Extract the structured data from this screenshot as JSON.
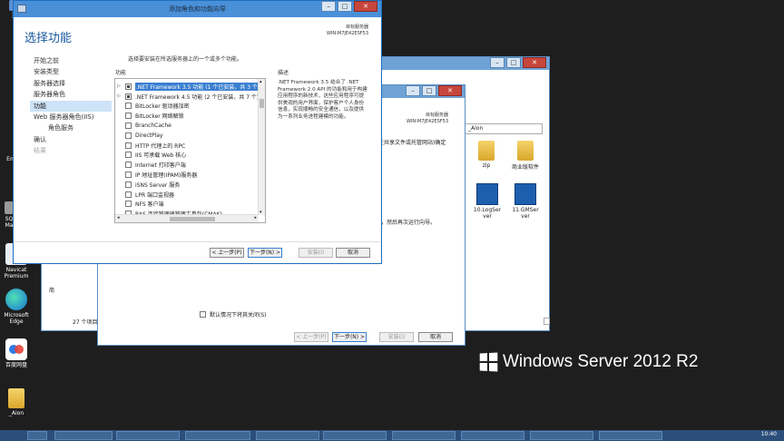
{
  "desktop": {
    "icons": [
      {
        "label": "Navicat Premium"
      },
      {
        "label": "Microsoft Edge"
      },
      {
        "label": "百度网盘"
      },
      {
        "label": "_Aion"
      }
    ],
    "edge_labels": [
      "这",
      "Em",
      "SQ",
      "Ma"
    ],
    "brand": "Windows Server 2012 R2"
  },
  "explorer": {
    "address": "_Aion",
    "files": [
      {
        "label": "zip"
      },
      {
        "label": "商业版软件"
      },
      {
        "label": "10.LogSer ver"
      },
      {
        "label": "11.GMSer ver"
      }
    ],
    "item_count": "27 个项目",
    "nav_partial": "简"
  },
  "back_wizard": {
    "server_label": "目标服务器",
    "server_name": "WIN-M7JE42ESF53",
    "text_share": "在共享文件或托管网站)确定",
    "text_run": "，然后再次运行向导。",
    "restart_checkbox": "默认情况下将其关闭(S)",
    "buttons": {
      "prev": "< 上一步(P)",
      "next": "下一步(N) >",
      "install": "安装(I)",
      "cancel": "取消"
    }
  },
  "wizard": {
    "title": "添加角色和功能向导",
    "heading": "选择功能",
    "server_label": "目标服务器",
    "server_name": "WIN-M7JE42ESF53",
    "nav": [
      {
        "label": "开始之前",
        "state": "normal"
      },
      {
        "label": "安装类型",
        "state": "normal"
      },
      {
        "label": "服务器选择",
        "state": "normal"
      },
      {
        "label": "服务器角色",
        "state": "normal"
      },
      {
        "label": "功能",
        "state": "active"
      },
      {
        "label": "Web 服务器角色(IIS)",
        "state": "normal"
      },
      {
        "label": "角色服务",
        "state": "sub"
      },
      {
        "label": "确认",
        "state": "normal"
      },
      {
        "label": "结果",
        "state": "disabled"
      }
    ],
    "instruction": "选择要安装在所选服务器上的一个或多个功能。",
    "features_label": "功能",
    "description_label": "描述",
    "features": [
      {
        "label": ".NET Framework 3.5 功能 (1 个已安装，共 3 个)",
        "expandable": true,
        "state": "partial",
        "selected": true
      },
      {
        "label": ".NET Framework 4.5 功能 (2 个已安装，共 7 个)",
        "expandable": true,
        "state": "partial",
        "selected": false
      },
      {
        "label": "BitLocker 驱动器加密",
        "expandable": false,
        "state": "none",
        "selected": false
      },
      {
        "label": "BitLocker 网络解锁",
        "expandable": false,
        "state": "none",
        "selected": false
      },
      {
        "label": "BranchCache",
        "expandable": false,
        "state": "none",
        "selected": false
      },
      {
        "label": "DirectPlay",
        "expandable": false,
        "state": "none",
        "selected": false
      },
      {
        "label": "HTTP 代理上的 RPC",
        "expandable": false,
        "state": "none",
        "selected": false
      },
      {
        "label": "IIS 可承载 Web 核心",
        "expandable": false,
        "state": "none",
        "selected": false
      },
      {
        "label": "Internet 打印客户端",
        "expandable": false,
        "state": "none",
        "selected": false
      },
      {
        "label": "IP 地址管理(IPAM)服务器",
        "expandable": false,
        "state": "none",
        "selected": false
      },
      {
        "label": "iSNS Server 服务",
        "expandable": false,
        "state": "none",
        "selected": false
      },
      {
        "label": "LPR 端口监视器",
        "expandable": false,
        "state": "none",
        "selected": false
      },
      {
        "label": "NFS 客户端",
        "expandable": false,
        "state": "none",
        "selected": false
      },
      {
        "label": "RAS 连接管理器管理工具包(CMAK)",
        "expandable": false,
        "state": "none",
        "selected": false
      }
    ],
    "description": ".NET Framework 3.5 结合了 .NET Framework 2.0 API 的功能和用于构建应用程序的新技术，这些应用程序可提供美观的用户界面，保护客户个人身份信息，实现顺畅的安全通信，以及提供为一系列业务进程建模的功能。",
    "buttons": {
      "prev": "< 上一步(P)",
      "next": "下一步(N) >",
      "install": "安装(I)",
      "cancel": "取消"
    }
  },
  "taskbar": {
    "time": "10:40"
  },
  "colors": {
    "titlebar": "#4a90d9",
    "heading": "#1a5aa0",
    "selection": "#3a7fd0",
    "taskbar": "#2b4f7a"
  }
}
